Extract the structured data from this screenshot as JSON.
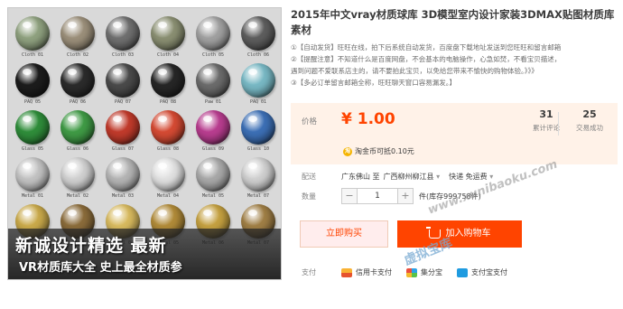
{
  "gallery": {
    "materials": [
      {
        "label": "Cloth 01",
        "color": "#8fa17f"
      },
      {
        "label": "Cloth 02",
        "color": "#9b8f7a"
      },
      {
        "label": "Cloth 03",
        "color": "#6f6f6f"
      },
      {
        "label": "Cloth 04",
        "color": "#8a8f72"
      },
      {
        "label": "Cloth 05",
        "color": "#a0a0a0"
      },
      {
        "label": "Cloth 06",
        "color": "#5d5d5d"
      },
      {
        "label": "PAQ 05",
        "color": "#1c1c1c"
      },
      {
        "label": "PAQ 06",
        "color": "#2b2b2b"
      },
      {
        "label": "PAQ 07",
        "color": "#4a4a4a"
      },
      {
        "label": "PAQ 08",
        "color": "#262626"
      },
      {
        "label": "Paw 01",
        "color": "#6b6b6b"
      },
      {
        "label": "PAQ 01",
        "color": "#78b8c4"
      },
      {
        "label": "Glass 05",
        "color": "#2f8d3a"
      },
      {
        "label": "Glass 06",
        "color": "#3f9a45"
      },
      {
        "label": "Glass 07",
        "color": "#c03a2b"
      },
      {
        "label": "Glass 08",
        "color": "#d44a33"
      },
      {
        "label": "Glass 09",
        "color": "#b83d8f"
      },
      {
        "label": "Glass 10",
        "color": "#3c6fb5"
      },
      {
        "label": "Metal 01",
        "color": "#c2c2c2"
      },
      {
        "label": "Metal 02",
        "color": "#d0d0d0"
      },
      {
        "label": "Metal 03",
        "color": "#b4b4b4"
      },
      {
        "label": "Metal 04",
        "color": "#e0e0e0"
      },
      {
        "label": "Metal 05",
        "color": "#a8a8a8"
      },
      {
        "label": "Metal 07",
        "color": "#cfcfcf"
      },
      {
        "label": "Metal 02",
        "color": "#c9a94a"
      },
      {
        "label": "Metal 03",
        "color": "#8a6b3a"
      },
      {
        "label": "Metal 04",
        "color": "#d7b95e"
      },
      {
        "label": "Metal 05",
        "color": "#b08a38"
      },
      {
        "label": "Metal 06",
        "color": "#c4a040"
      },
      {
        "label": "Metal 07",
        "color": "#9f7e45"
      }
    ],
    "banner_line1": "新诚设计精选    最新",
    "banner_line2": "VR材质库大全  史上最全材质参"
  },
  "product": {
    "title": "2015年中文vray材质球库 3D模型室内设计家装3DMAX贴图材质库素材",
    "desc": [
      "①【自动发货】旺旺在线，拍下后系统自动发货，百度盘下载地址发送到您旺旺和留言邮箱",
      "②【提醒注意】不知道什么是百度网盘，不会基本的电脑操作，心急如焚，不看宝贝描述，",
      "遇到问题不爱联系店主的，请不要拍此宝贝，以免给您带来不愉快的购物体验。》》》",
      "③【多必订单留言邮箱全称，旺旺聊天窗口容易漏发。】"
    ]
  },
  "price": {
    "label": "价格",
    "value": "¥ 1.00",
    "reviews_count": "31",
    "reviews_label": "累计评论",
    "sales_count": "25",
    "sales_label": "交易成功",
    "coin_icon": "淘",
    "coin_text": "淘金币可抵0.10元"
  },
  "shipping": {
    "label": "配送",
    "from": "广东佛山 至",
    "to": "广西柳州柳江县",
    "method": "快递 免运费"
  },
  "quantity": {
    "label": "数量",
    "minus": "−",
    "value": "1",
    "plus": "+",
    "stock": "件(库存999758件)"
  },
  "actions": {
    "buy_now": "立即购买",
    "add_to_cart": "加入购物车"
  },
  "payment": {
    "label": "支付",
    "methods": [
      "信用卡支付",
      "集分宝",
      "支付宝支付"
    ]
  },
  "watermark": {
    "url": "www.xunibaoku.com",
    "brand": "虚拟宝库"
  },
  "colors": {
    "accent": "#ff4400",
    "price_bg": "#fff2e8"
  }
}
